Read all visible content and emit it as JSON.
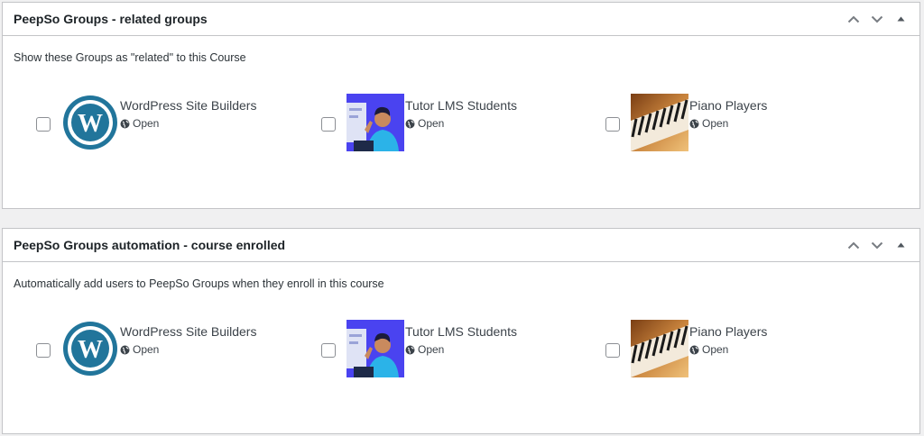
{
  "boxes": [
    {
      "title": "PeepSo Groups - related groups",
      "description": "Show these Groups as \"related\" to this Course",
      "groups": [
        {
          "name": "WordPress Site Builders",
          "privacy": "Open"
        },
        {
          "name": "Tutor LMS Students",
          "privacy": "Open"
        },
        {
          "name": "Piano Players",
          "privacy": "Open"
        }
      ]
    },
    {
      "title": "PeepSo Groups automation - course enrolled",
      "description": "Automatically add users to PeepSo Groups when they enroll in this course",
      "groups": [
        {
          "name": "WordPress Site Builders",
          "privacy": "Open"
        },
        {
          "name": "Tutor LMS Students",
          "privacy": "Open"
        },
        {
          "name": "Piano Players",
          "privacy": "Open"
        }
      ]
    }
  ],
  "icons": {
    "move_up": "chevron-up-icon",
    "move_down": "chevron-down-icon",
    "toggle": "triangle-up-icon",
    "privacy": "globe-icon"
  },
  "colors": {
    "page_bg": "#f0f0f1",
    "box_border": "#c3c4c7",
    "text": "#1d2327",
    "wp_logo_blue": "#21759b",
    "tutor_bg": "#4a43f0",
    "piano_wood": "#c9843d"
  }
}
